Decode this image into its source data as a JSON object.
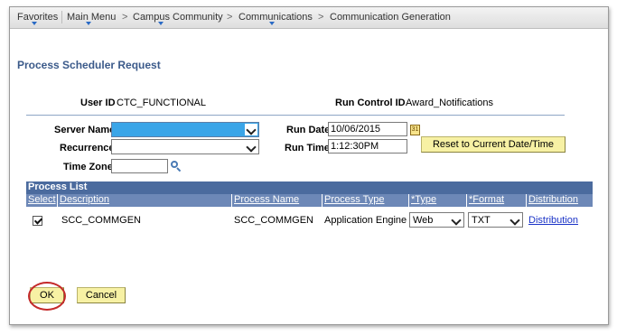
{
  "nav": {
    "favorites": "Favorites",
    "main_menu": "Main Menu",
    "campus_community": "Campus Community",
    "communications": "Communications",
    "communication_generation": "Communication Generation",
    "sep_arrow": ">"
  },
  "page": {
    "title": "Process Scheduler Request"
  },
  "header_fields": {
    "user_id_label": "User ID",
    "user_id_value": "CTC_FUNCTIONAL",
    "run_control_label": "Run Control ID",
    "run_control_value": "Award_Notifications"
  },
  "form": {
    "server_name_label": "Server Name",
    "server_name_value": "",
    "recurrence_label": "Recurrence",
    "recurrence_value": "",
    "time_zone_label": "Time Zone",
    "time_zone_value": "",
    "run_date_label": "Run Date",
    "run_date_value": "10/06/2015",
    "run_time_label": "Run Time",
    "run_time_value": "1:12:30PM",
    "reset_button": "Reset to Current Date/Time",
    "calendar_icon_text": "31"
  },
  "process_list": {
    "title": "Process List",
    "columns": {
      "select": "Select",
      "description": "Description",
      "process_name": "Process Name",
      "process_type": "Process Type",
      "type": "*Type",
      "format": "*Format",
      "distribution": "Distribution"
    },
    "rows": [
      {
        "selected": true,
        "description": "SCC_COMMGEN",
        "process_name": "SCC_COMMGEN",
        "process_type": "Application Engine",
        "type": "Web",
        "format": "TXT",
        "distribution": "Distribution"
      }
    ]
  },
  "buttons": {
    "ok": "OK",
    "cancel": "Cancel"
  },
  "colors": {
    "grid_header": "#4b6b9e",
    "grid_columns": "#6d88b7",
    "button_yellow": "#f7f1a4",
    "highlight_select": "#3aa5e8",
    "annotation_circle": "#c42a2a"
  }
}
